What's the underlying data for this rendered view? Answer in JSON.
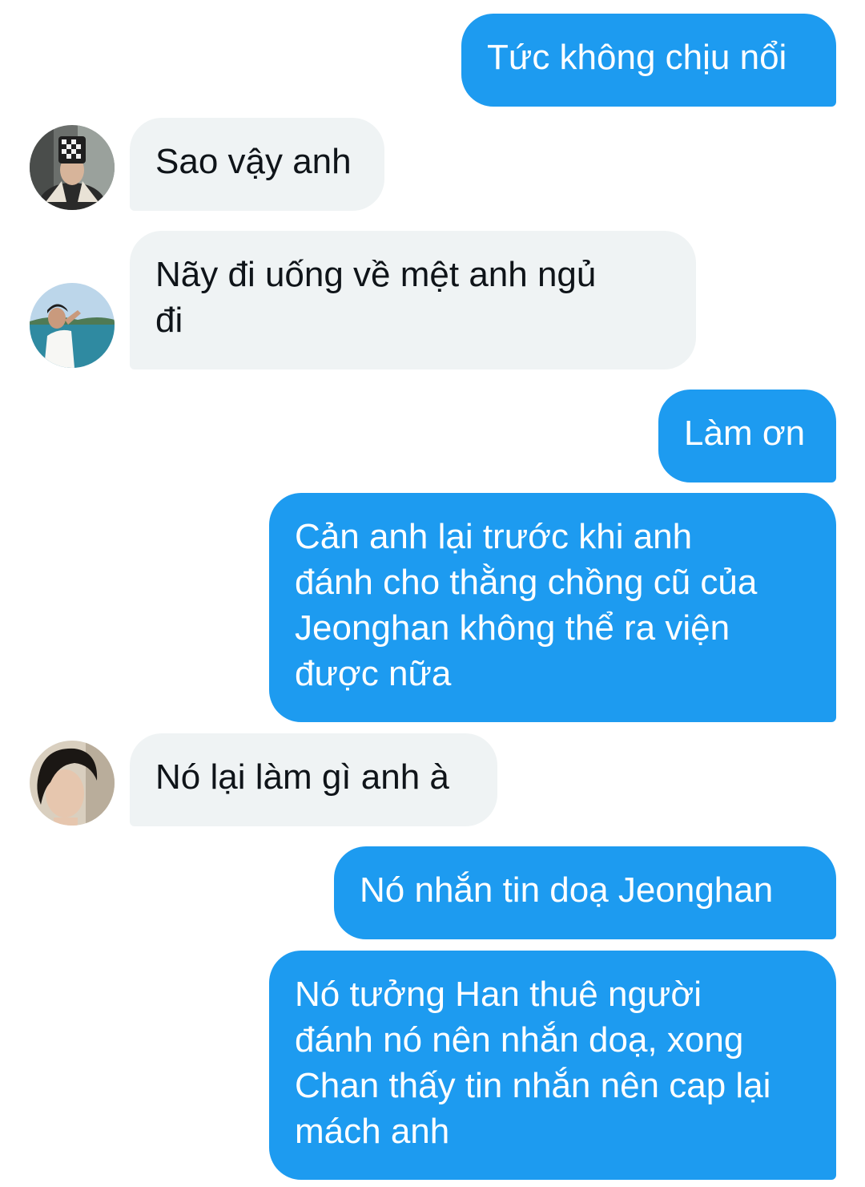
{
  "messages": [
    {
      "direction": "sent",
      "text": "Tức không chịu nổi"
    },
    {
      "direction": "received",
      "text": "Sao vậy anh"
    },
    {
      "direction": "received",
      "text": "Nãy đi uống về mệt anh ngủ\nđi"
    },
    {
      "direction": "sent",
      "text": "Làm ơn"
    },
    {
      "direction": "sent",
      "text": "Cản anh lại trước khi anh\nđánh cho thằng chồng cũ của\nJeonghan không thể ra viện\nđược nữa"
    },
    {
      "direction": "received",
      "text": "Nó lại làm gì anh à"
    },
    {
      "direction": "sent",
      "text": "Nó nhắn tin doạ Jeonghan"
    },
    {
      "direction": "sent",
      "text": "Nó tưởng Han thuê người\nđánh nó nên nhắn doạ, xong\nChan thấy tin nhắn nên cap lại\nmách anh"
    }
  ],
  "avatars": [
    {
      "name": "avatar-1",
      "icon": "user-photo"
    },
    {
      "name": "avatar-2",
      "icon": "user-photo"
    },
    {
      "name": "avatar-3",
      "icon": "user-photo"
    }
  ],
  "colors": {
    "sent_bubble": "#1d9bf0",
    "sent_text": "#ffffff",
    "received_bubble": "#eff3f4",
    "received_text": "#0f1419"
  }
}
